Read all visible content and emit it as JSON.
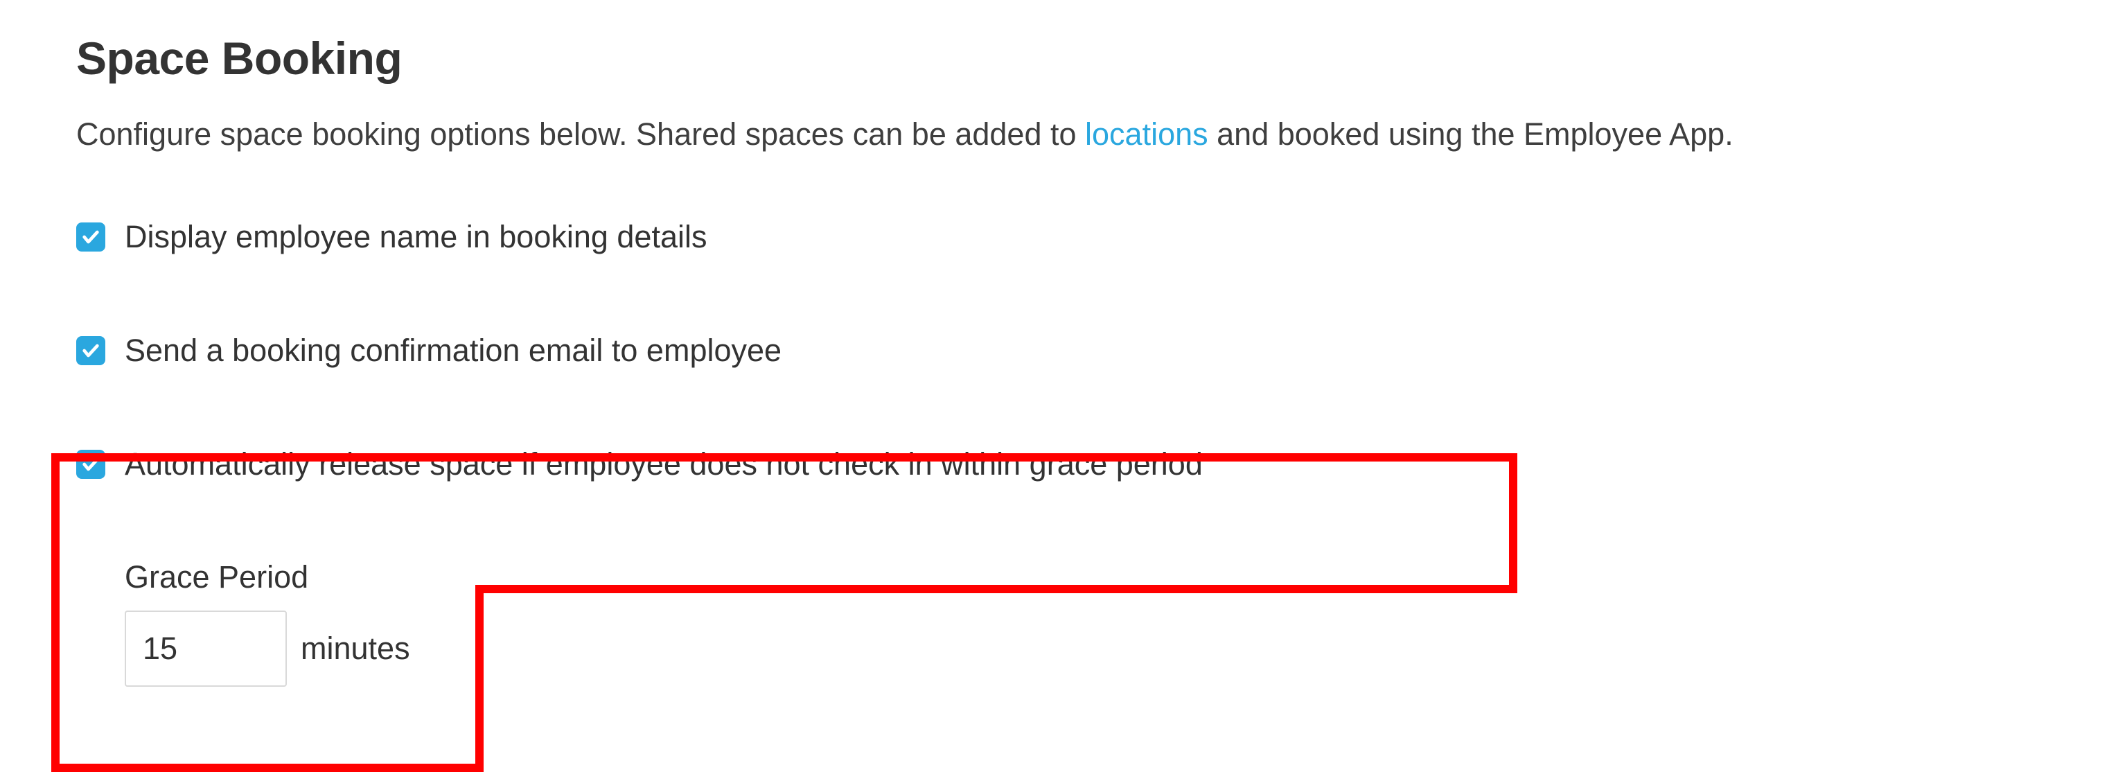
{
  "heading": "Space Booking",
  "description": {
    "pre": "Configure space booking options below. Shared spaces can be added to ",
    "link": "locations",
    "post": " and booked using the Employee App."
  },
  "options": [
    {
      "label": "Display employee name in booking details",
      "checked": true
    },
    {
      "label": "Send a booking confirmation email to employee",
      "checked": true
    },
    {
      "label": "Automatically release space if employee does not check in within grace period",
      "checked": true
    }
  ],
  "grace": {
    "label": "Grace Period",
    "value": "15",
    "unit": "minutes"
  },
  "colors": {
    "accent": "#2aa7df",
    "highlight": "#ff0000"
  }
}
